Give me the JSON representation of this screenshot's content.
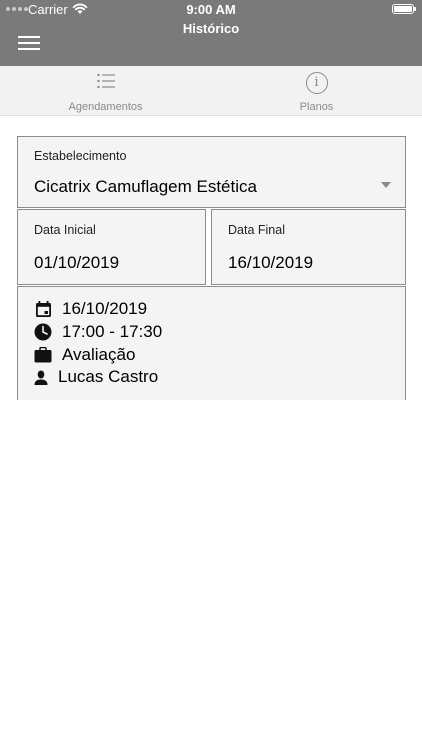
{
  "status_bar": {
    "carrier": "Carrier",
    "time": "9:00 AM"
  },
  "header": {
    "title": "Histórico"
  },
  "tabs": [
    {
      "label": "Agendamentos",
      "icon": "list-icon"
    },
    {
      "label": "Planos",
      "icon": "info-icon",
      "icon_glyph": "i"
    }
  ],
  "filters": {
    "estabelecimento": {
      "label": "Estabelecimento",
      "value": "Cicatrix Camuflagem Estética"
    },
    "data_inicial": {
      "label": "Data Inicial",
      "value": "01/10/2019"
    },
    "data_final": {
      "label": "Data Final",
      "value": "16/10/2019"
    }
  },
  "appointment": {
    "date": "16/10/2019",
    "time": "17:00 - 17:30",
    "service": "Avaliação",
    "professional": "Lucas Castro"
  },
  "colors": {
    "header_bg": "#7a7a7a",
    "tab_bar_bg": "#f2f2f2",
    "card_bg": "#f4f4f4",
    "card_border": "#8c8c8c",
    "muted_text": "#8a8a8a"
  }
}
